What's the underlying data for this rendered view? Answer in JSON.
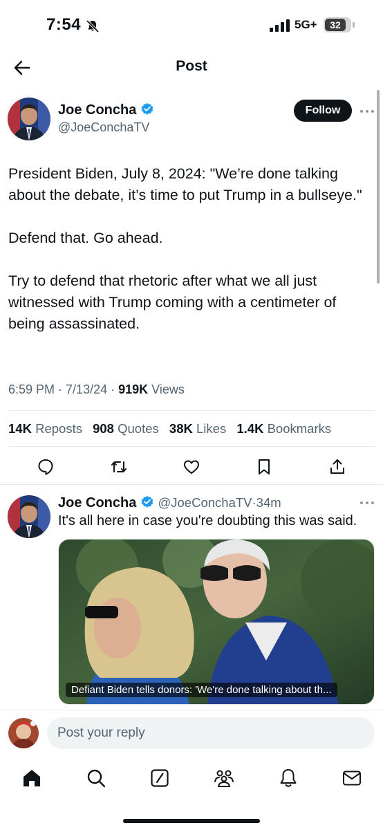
{
  "status_bar": {
    "time": "7:54",
    "network": "5G+",
    "battery": "32"
  },
  "header": {
    "title": "Post"
  },
  "post": {
    "author_name": "Joe Concha",
    "author_handle": "@JoeConchaTV",
    "follow_label": "Follow",
    "paragraphs": [
      "President Biden, July 8, 2024: \"We’re done talking about the debate, it’s time to put Trump in a bullseye.\"",
      "Defend that. Go ahead.",
      "Try to defend that rhetoric after what we all just witnessed with Trump coming with a centimeter of being assassinated."
    ],
    "time": "6:59 PM",
    "date": "7/13/24",
    "views_count": "919K",
    "views_label": "Views",
    "stats": {
      "reposts_count": "14K",
      "reposts_label": "Reposts",
      "quotes_count": "908",
      "quotes_label": "Quotes",
      "likes_count": "38K",
      "likes_label": "Likes",
      "bookmarks_count": "1.4K",
      "bookmarks_label": "Bookmarks"
    }
  },
  "reply": {
    "author_name": "Joe Concha",
    "author_handle": "@JoeConchaTV",
    "age": "34m",
    "text": "It's all here in case you're doubting this was said.",
    "media_caption": "Defiant Biden tells donors: 'We're done talking about th..."
  },
  "composer": {
    "placeholder": "Post your reply"
  },
  "colors": {
    "primary_text": "#0f1419",
    "secondary_text": "#536471",
    "verified_blue": "#1d9bf0",
    "divider": "#e7e9ea"
  },
  "icons": {
    "back": "arrow-left-icon",
    "verified": "verified-badge-icon",
    "more": "more-horizontal-icon",
    "reply": "comment-icon",
    "repost": "repost-icon",
    "like": "heart-icon",
    "bookmark": "bookmark-icon",
    "share": "share-icon",
    "nav": [
      "home-icon",
      "search-icon",
      "grok-icon",
      "communities-icon",
      "notifications-icon",
      "messages-icon"
    ]
  }
}
